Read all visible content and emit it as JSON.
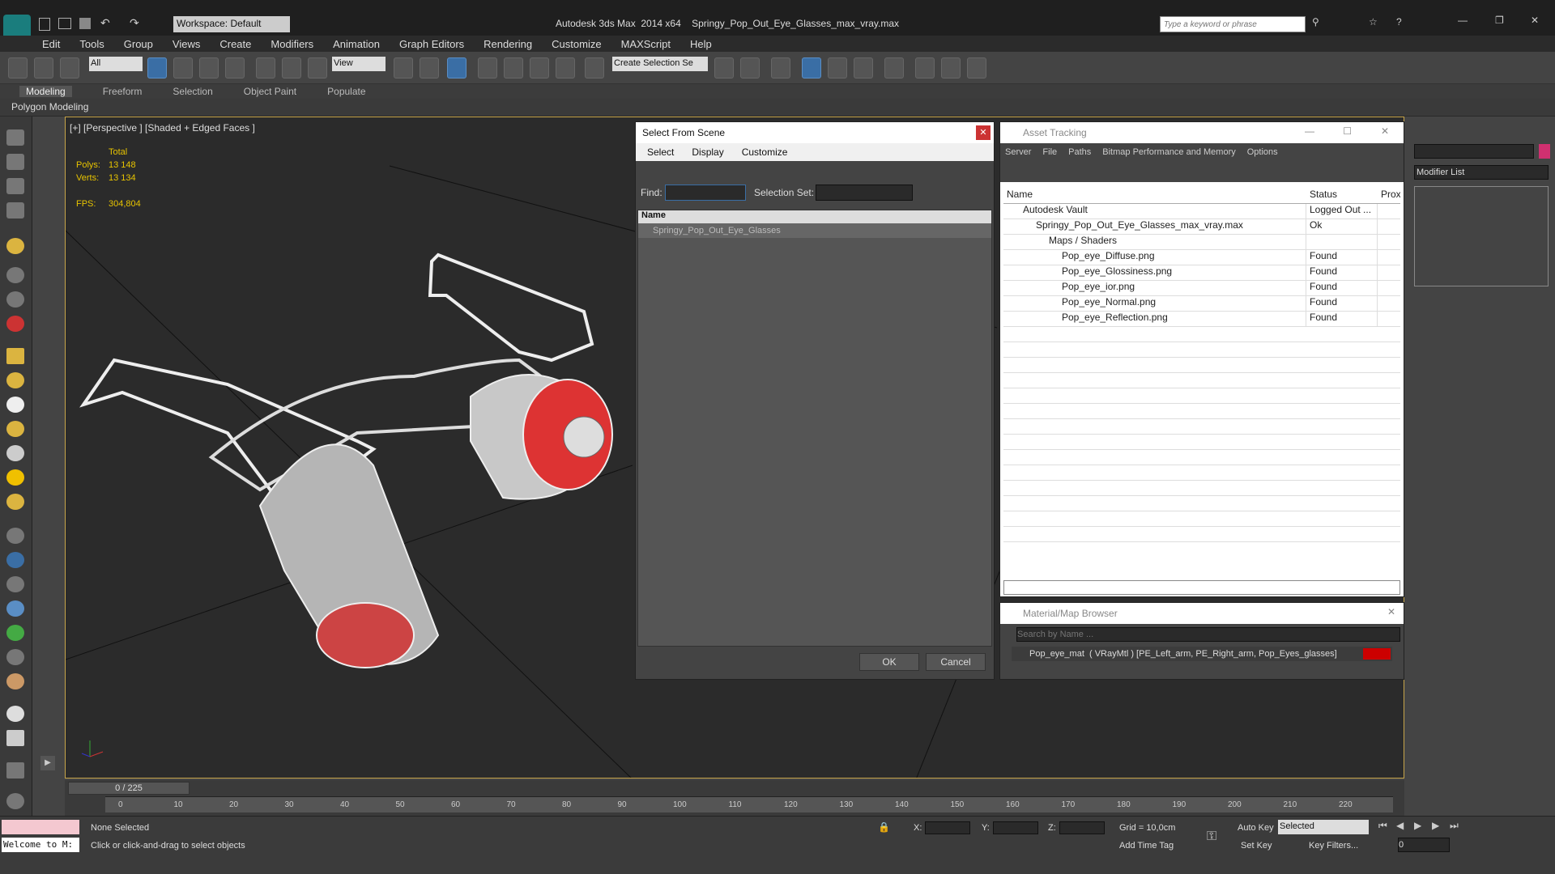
{
  "app": {
    "title": "Autodesk 3ds Max  2014 x64    Springy_Pop_Out_Eye_Glasses_max_vray.max",
    "workspace": "Workspace: Default",
    "search_placeholder": "Type a keyword or phrase"
  },
  "menu": [
    "Edit",
    "Tools",
    "Group",
    "Views",
    "Create",
    "Modifiers",
    "Animation",
    "Graph Editors",
    "Rendering",
    "Customize",
    "MAXScript",
    "Help"
  ],
  "toolbar": {
    "filter": "All",
    "ref_coord": "View",
    "selection_set": "Create Selection Se"
  },
  "ribbon": {
    "tabs": [
      "Modeling",
      "Freeform",
      "Selection",
      "Object Paint",
      "Populate"
    ],
    "active": "Modeling",
    "sub": "Polygon Modeling"
  },
  "viewport": {
    "label": "[+] [Perspective ] [Shaded + Edged Faces ]",
    "stats": {
      "total": "Total",
      "polys_label": "Polys:",
      "polys": "13 148",
      "verts_label": "Verts:",
      "verts": "13 134",
      "fps_label": "FPS:",
      "fps": "304,804"
    }
  },
  "select_scene": {
    "title": "Select From Scene",
    "menu": [
      "Select",
      "Display",
      "Customize"
    ],
    "find_label": "Find:",
    "selset_label": "Selection Set:",
    "column": "Name",
    "items": [
      "Springy_Pop_Out_Eye_Glasses"
    ],
    "ok": "OK",
    "cancel": "Cancel"
  },
  "asset_tracking": {
    "title": "Asset Tracking",
    "menu": [
      "Server",
      "File",
      "Paths",
      "Bitmap Performance and Memory",
      "Options"
    ],
    "columns": [
      "Name",
      "Status",
      "Prox"
    ],
    "rows": [
      {
        "name": "Autodesk Vault",
        "status": "Logged Out ..."
      },
      {
        "name": "Springy_Pop_Out_Eye_Glasses_max_vray.max",
        "status": "Ok"
      },
      {
        "name": "Maps / Shaders",
        "status": ""
      },
      {
        "name": "Pop_eye_Diffuse.png",
        "status": "Found"
      },
      {
        "name": "Pop_eye_Glossiness.png",
        "status": "Found"
      },
      {
        "name": "Pop_eye_ior.png",
        "status": "Found"
      },
      {
        "name": "Pop_eye_Normal.png",
        "status": "Found"
      },
      {
        "name": "Pop_eye_Reflection.png",
        "status": "Found"
      }
    ]
  },
  "material_browser": {
    "title": "Material/Map Browser",
    "search_placeholder": "Search by Name ...",
    "item": "Pop_eye_mat  ( VRayMtl ) [PE_Left_arm, PE_Right_arm, Pop_Eyes_glasses]"
  },
  "modifier_list": "Modifier List",
  "timeline": {
    "frame": "0 / 225",
    "ticks": [
      "0",
      "10",
      "20",
      "30",
      "40",
      "50",
      "60",
      "70",
      "80",
      "90",
      "100",
      "110",
      "120",
      "130",
      "140",
      "150",
      "160",
      "170",
      "180",
      "190",
      "200",
      "210",
      "220"
    ]
  },
  "status": {
    "welcome": "Welcome to M:",
    "selection": "None Selected",
    "hint": "Click or click-and-drag to select objects",
    "x": "X:",
    "y": "Y:",
    "z": "Z:",
    "grid": "Grid = 10,0cm",
    "add_time_tag": "Add Time Tag",
    "auto_key": "Auto Key",
    "set_key": "Set Key",
    "selected": "Selected",
    "key_filters": "Key Filters...",
    "frame_value": "0"
  }
}
